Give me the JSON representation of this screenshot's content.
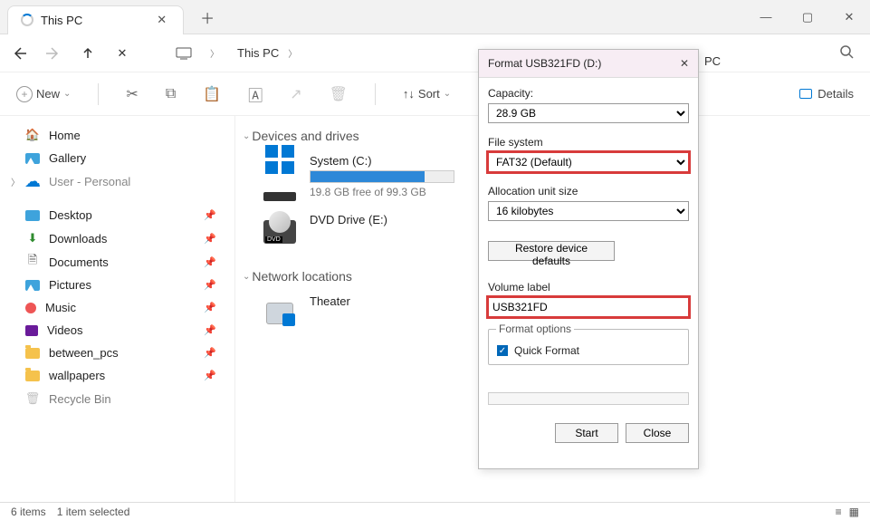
{
  "tab": {
    "title": "This PC"
  },
  "breadcrumb": {
    "root": "This PC",
    "tail": "PC"
  },
  "toolbar": {
    "new_label": "New",
    "sort_label": "Sort",
    "details_label": "Details"
  },
  "sidebar": {
    "items": [
      {
        "label": "Home"
      },
      {
        "label": "Gallery"
      },
      {
        "label": "User - Personal"
      },
      {
        "label": "Desktop"
      },
      {
        "label": "Downloads"
      },
      {
        "label": "Documents"
      },
      {
        "label": "Pictures"
      },
      {
        "label": "Music"
      },
      {
        "label": "Videos"
      },
      {
        "label": "between_pcs"
      },
      {
        "label": "wallpapers"
      },
      {
        "label": "Recycle Bin"
      }
    ]
  },
  "main": {
    "section_devices": "Devices and drives",
    "section_network": "Network locations",
    "drives": [
      {
        "name": "System (C:)",
        "sub": "19.8 GB free of 99.3 GB",
        "fill_pct": 80
      },
      {
        "name": "DVD Drive (E:)"
      }
    ],
    "network": [
      {
        "name": "Theater"
      }
    ]
  },
  "status": {
    "items": "6 items",
    "selected": "1 item selected"
  },
  "dialog": {
    "title": "Format USB321FD (D:)",
    "capacity_label": "Capacity:",
    "capacity_value": "28.9 GB",
    "fs_label": "File system",
    "fs_value": "FAT32 (Default)",
    "alloc_label": "Allocation unit size",
    "alloc_value": "16 kilobytes",
    "restore_label": "Restore device defaults",
    "vol_label": "Volume label",
    "vol_value": "USB321FD",
    "options_label": "Format options",
    "quick_label": "Quick Format",
    "start_label": "Start",
    "close_label": "Close"
  }
}
